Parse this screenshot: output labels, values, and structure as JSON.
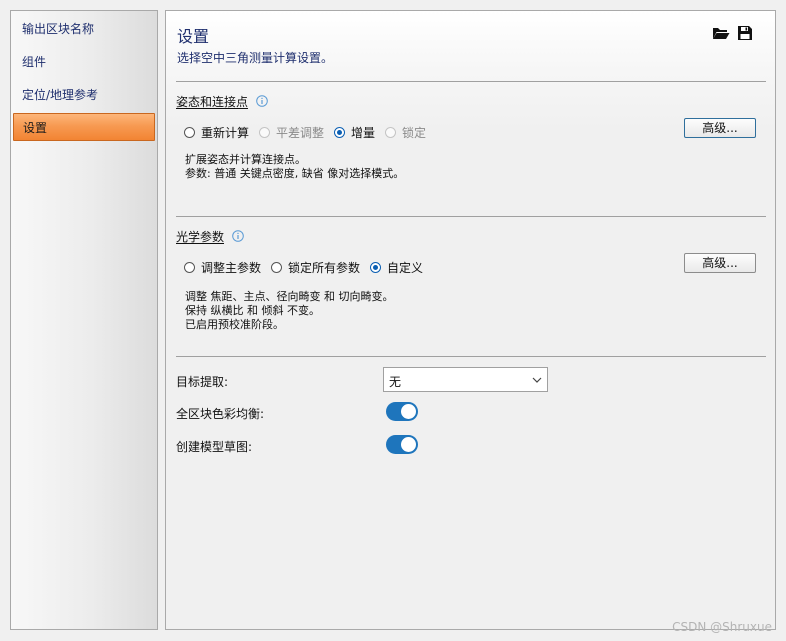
{
  "sidebar": {
    "items": [
      {
        "label": "输出区块名称"
      },
      {
        "label": "组件"
      },
      {
        "label": "定位/地理参考"
      },
      {
        "label": "设置",
        "active": true
      }
    ]
  },
  "header": {
    "title": "设置",
    "subtitle": "选择空中三角测量计算设置。",
    "icons": [
      "folder-open-icon",
      "save-icon"
    ]
  },
  "pose": {
    "heading": "姿态和连接点",
    "options": [
      {
        "label": "重新计算",
        "checked": false,
        "enabled": true
      },
      {
        "label": "平差调整",
        "checked": false,
        "enabled": false
      },
      {
        "label": "增量",
        "checked": true,
        "enabled": true
      },
      {
        "label": "锁定",
        "checked": false,
        "enabled": false
      }
    ],
    "advanced_label": "高级...",
    "description": [
      "扩展姿态并计算连接点。",
      "参数: 普通 关键点密度, 缺省 像对选择模式。"
    ]
  },
  "optical": {
    "heading": "光学参数",
    "options": [
      {
        "label": "调整主参数",
        "checked": false,
        "enabled": true
      },
      {
        "label": "锁定所有参数",
        "checked": false,
        "enabled": true
      },
      {
        "label": "自定义",
        "checked": true,
        "enabled": true
      }
    ],
    "advanced_label": "高级...",
    "description": [
      "调整 焦距、主点、径向畸变 和 切向畸变。",
      "保持 纵横比 和 倾斜 不变。",
      "已启用预校准阶段。"
    ]
  },
  "fields": {
    "target_label": "目标提取:",
    "target_value": "无",
    "color_balance_label": "全区块色彩均衡:",
    "color_balance_on": true,
    "sketch_label": "创建模型草图:",
    "sketch_on": true
  },
  "colors": {
    "accent": "#1e75bc",
    "active_nav": "#f79a52",
    "heading_text": "#1f2f6e"
  },
  "watermark": "CSDN @Shruxue"
}
